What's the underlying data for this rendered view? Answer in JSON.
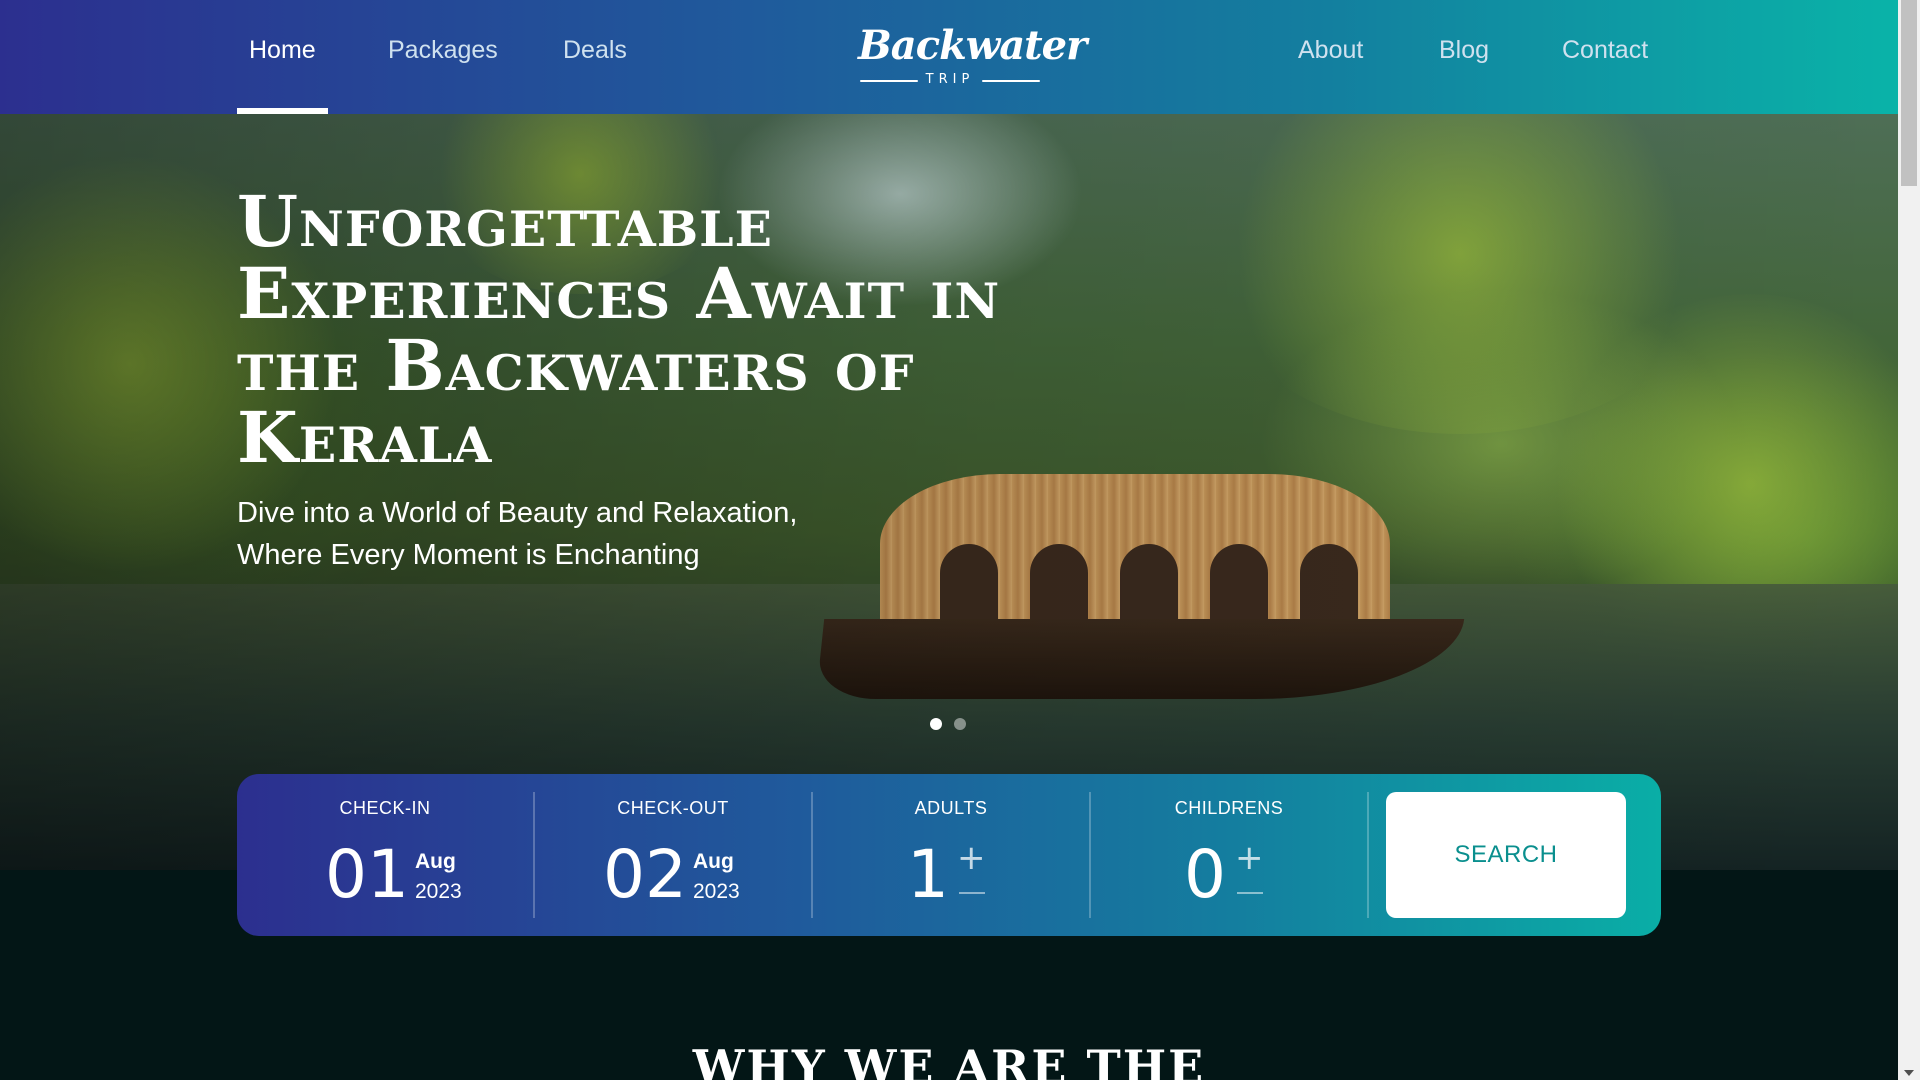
{
  "nav": {
    "left": [
      {
        "label": "Home",
        "active": true
      },
      {
        "label": "Packages",
        "active": false
      },
      {
        "label": "Deals",
        "active": false
      }
    ],
    "right": [
      {
        "label": "About"
      },
      {
        "label": "Blog"
      },
      {
        "label": "Contact"
      }
    ],
    "logo": {
      "main": "Backwater",
      "sub": "TRIP"
    }
  },
  "hero": {
    "title": "Unforgettable Experiences Await in the Backwaters of Kerala",
    "subtitle": "Dive into a World of Beauty and Relaxation, Where Every Moment is Enchanting",
    "slides": 2,
    "active_slide": 1
  },
  "booking": {
    "checkin": {
      "label": "CHECK-IN",
      "day": "01",
      "month": "Aug",
      "year": "2023"
    },
    "checkout": {
      "label": "CHECK-OUT",
      "day": "02",
      "month": "Aug",
      "year": "2023"
    },
    "adults": {
      "label": "ADULTS",
      "value": "1"
    },
    "children": {
      "label": "CHILDRENS",
      "value": "0"
    },
    "search_label": "SEARCH"
  },
  "section": {
    "why_title": "WHY WE ARE THE"
  },
  "colors": {
    "gradient_start": "#2c2f8f",
    "gradient_end": "#0ab3a8",
    "search_text": "#0a8f8e",
    "dark_bg": "#031616"
  },
  "icons": {
    "plus": "plus-icon",
    "minus": "minus-icon"
  }
}
